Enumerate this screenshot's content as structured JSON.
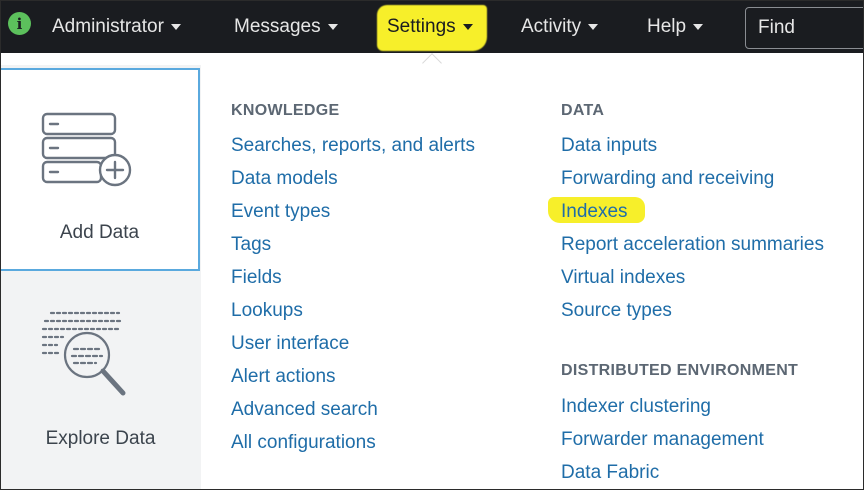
{
  "topbar": {
    "info_glyph": "i",
    "nav": {
      "administrator": "Administrator",
      "messages": "Messages",
      "settings": "Settings",
      "activity": "Activity",
      "help": "Help"
    },
    "find_placeholder": "Find"
  },
  "tiles": {
    "add_data": "Add Data",
    "explore_data": "Explore Data"
  },
  "knowledge": {
    "title": "KNOWLEDGE",
    "links": [
      "Searches, reports, and alerts",
      "Data models",
      "Event types",
      "Tags",
      "Fields",
      "Lookups",
      "User interface",
      "Alert actions",
      "Advanced search",
      "All configurations"
    ]
  },
  "data": {
    "title": "DATA",
    "links": [
      "Data inputs",
      "Forwarding and receiving",
      "Indexes",
      "Report acceleration summaries",
      "Virtual indexes",
      "Source types"
    ]
  },
  "distributed": {
    "title": "DISTRIBUTED ENVIRONMENT",
    "links": [
      "Indexer clustering",
      "Forwarder management",
      "Data Fabric"
    ]
  },
  "colors": {
    "topbar_bg": "#1a1c20",
    "highlight": "#f7ef2a",
    "link": "#1f6da8",
    "section_title": "#5c6773",
    "tile_border": "#5aa9de",
    "badge": "#5cc05c"
  },
  "icons": {
    "info": "info-badge-icon",
    "caret": "caret-down-icon",
    "add_data": "server-add-icon",
    "explore_data": "data-search-icon"
  }
}
